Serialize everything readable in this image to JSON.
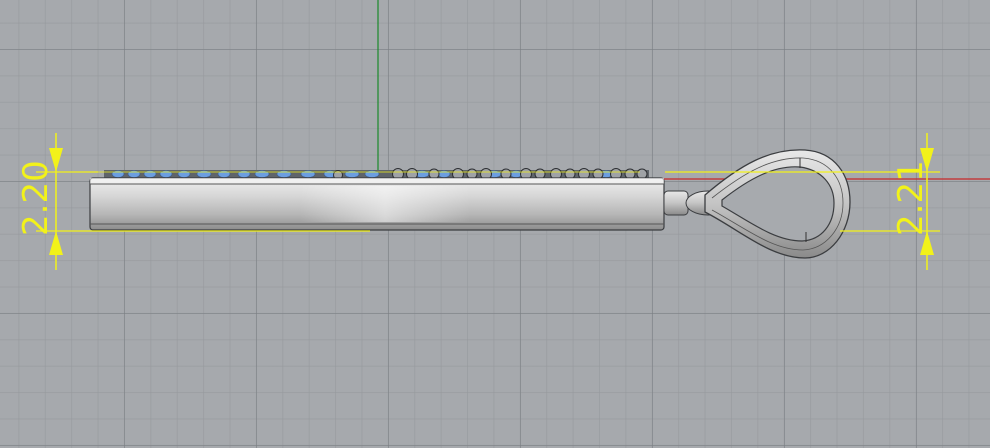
{
  "viewport": {
    "dimension_left": "2.20",
    "dimension_right": "2.21"
  },
  "colors": {
    "dimension": "#f2f21a",
    "x_axis": "#c8282a",
    "y_axis": "#1a8a2a",
    "gem_blue": "#6b9ee0",
    "metal": "#c9c9c9"
  },
  "icons": [
    "pendant-body",
    "pendant-bail",
    "gem-row"
  ]
}
